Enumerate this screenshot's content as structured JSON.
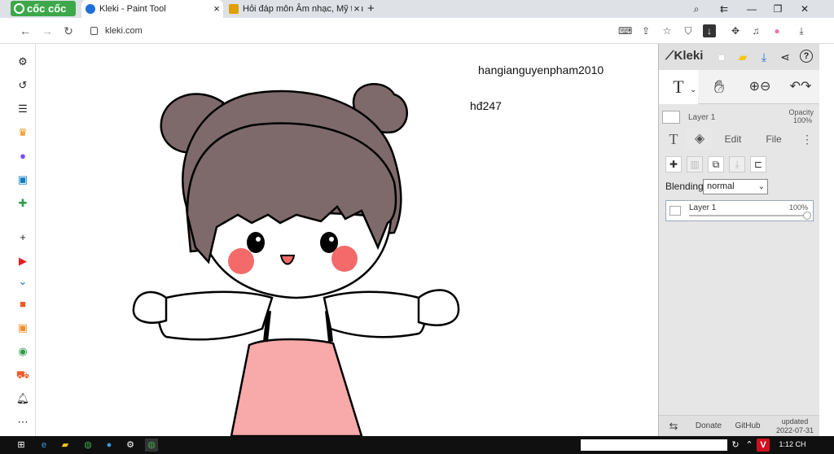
{
  "browser": {
    "brand": "cốc cốc",
    "tabs": [
      {
        "title": "Kleki - Paint Tool",
        "active": true
      },
      {
        "title": "Hỏi đáp môn Âm nhạc, Mỹ thuật",
        "active": false
      }
    ],
    "new_tab": "+",
    "url": "kleki.com"
  },
  "canvas": {
    "text_lines": [
      "hangianguyenpham2010",
      "hđ247"
    ],
    "colors": {
      "hair": "#7e6a6a",
      "blush": "#f46a6a",
      "dress": "#f8a9a9",
      "outline": "#000000"
    }
  },
  "kleki": {
    "logo": "Kleki",
    "layer_name": "Layer 1",
    "opacity_label": "Opacity",
    "opacity_value": "100%",
    "tabs": [
      "T",
      "Edit",
      "File"
    ],
    "blending_label": "Blending",
    "blending_value": "normal",
    "layer_item_name": "Layer 1",
    "layer_item_opacity": "100%",
    "footer": {
      "donate": "Donate",
      "github": "GitHub",
      "updated": "updated",
      "updated_date": "2022-07-31"
    }
  },
  "taskbar": {
    "time": "1:12 CH"
  }
}
